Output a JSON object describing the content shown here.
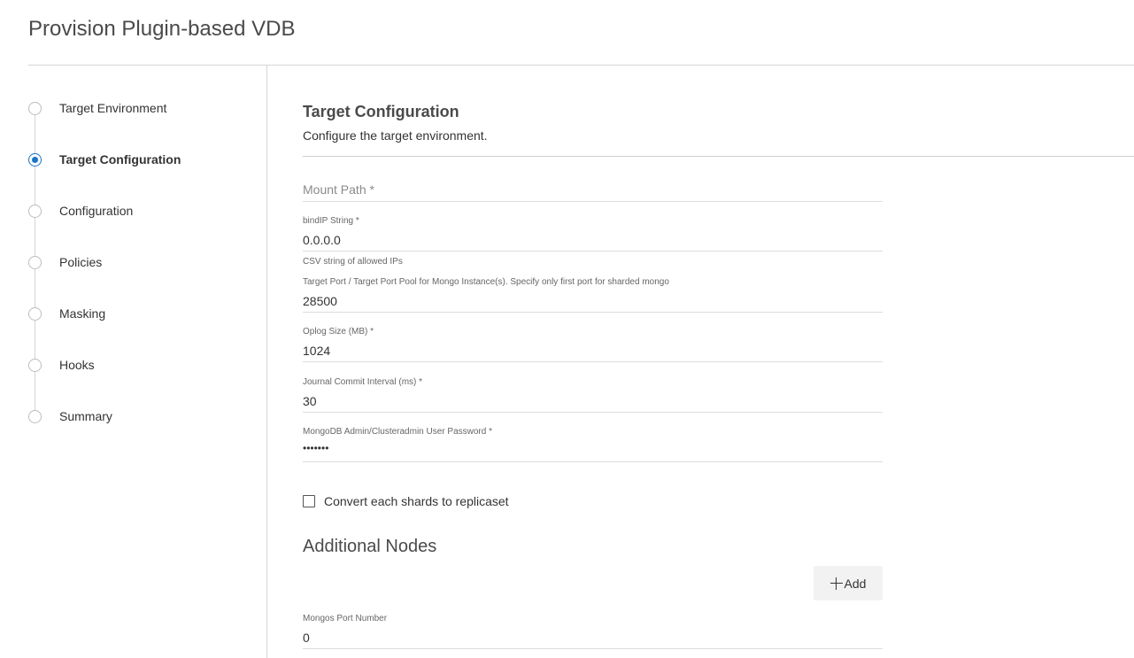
{
  "page": {
    "title": "Provision Plugin-based VDB"
  },
  "stepper": {
    "steps": [
      {
        "label": "Target Environment",
        "active": false
      },
      {
        "label": "Target Configuration",
        "active": true
      },
      {
        "label": "Configuration",
        "active": false
      },
      {
        "label": "Policies",
        "active": false
      },
      {
        "label": "Masking",
        "active": false
      },
      {
        "label": "Hooks",
        "active": false
      },
      {
        "label": "Summary",
        "active": false
      }
    ]
  },
  "section": {
    "title": "Target Configuration",
    "subtitle": "Configure the target environment."
  },
  "form": {
    "mount_path": {
      "placeholder": "Mount Path *",
      "value": ""
    },
    "bindip": {
      "label": "bindIP String *",
      "value": "0.0.0.0",
      "helper": "CSV string of allowed IPs"
    },
    "target_port": {
      "label": "Target Port / Target Port Pool for Mongo Instance(s). Specify only first port for sharded mongo",
      "value": "28500"
    },
    "oplog_size": {
      "label": "Oplog Size (MB) *",
      "value": "1024"
    },
    "journal_commit": {
      "label": "Journal Commit Interval (ms) *",
      "value": "30"
    },
    "admin_password": {
      "label": "MongoDB Admin/Clusteradmin User Password *",
      "value": "•••••••"
    },
    "convert_shards": {
      "label": "Convert each shards to replicaset",
      "checked": false
    }
  },
  "additional_nodes": {
    "title": "Additional Nodes",
    "add_label": "Add"
  },
  "mongos": {
    "label": "Mongos Port Number",
    "value": "0"
  },
  "colors": {
    "accent": "#1a73c8",
    "rule": "#d6d6d6",
    "button_bg": "#f2f2f2"
  }
}
